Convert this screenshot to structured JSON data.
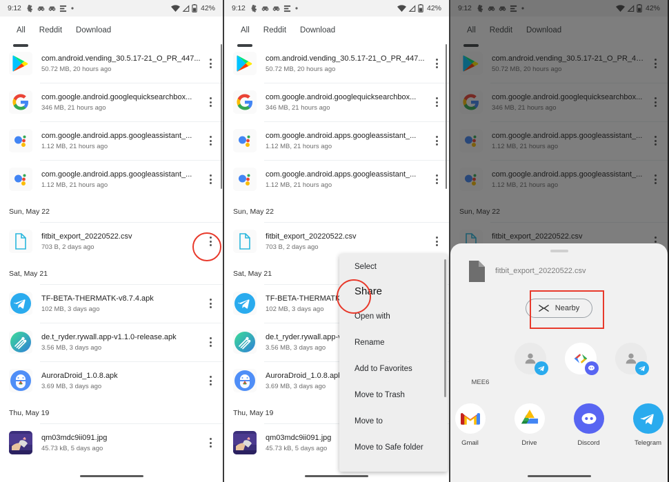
{
  "status_bar": {
    "time": "9:12",
    "battery_text": "42%",
    "left_icons": [
      "app-notification-icon",
      "car-notification-icon",
      "car-notification-icon",
      "list-notification-icon",
      "dot-notification-icon"
    ],
    "right_icons": [
      "wifi-icon",
      "signal-icon",
      "battery-icon"
    ]
  },
  "tabs": [
    {
      "label": "All",
      "selected": true
    },
    {
      "label": "Reddit",
      "selected": false
    },
    {
      "label": "Download",
      "selected": false
    }
  ],
  "files": [
    {
      "name": "com.android.vending_30.5.17-21_O_PR_447...",
      "meta": "50.72 MB, 20 hours ago",
      "icon": "play-store-icon"
    },
    {
      "name": "com.google.android.googlequicksearchbox...",
      "meta": "346 MB, 21 hours ago",
      "icon": "google-icon"
    },
    {
      "name": "com.google.android.apps.googleassistant_...",
      "meta": "1.12 MB, 21 hours ago",
      "icon": "google-assistant-icon"
    },
    {
      "name": "com.google.android.apps.googleassistant_...",
      "meta": "1.12 MB, 21 hours ago",
      "icon": "google-assistant-icon"
    }
  ],
  "groups": [
    {
      "date": "Sun, May 22",
      "files": [
        {
          "name": "fitbit_export_20220522.csv",
          "meta": "703 B, 2 days ago",
          "icon": "csv-document-icon"
        }
      ]
    },
    {
      "date": "Sat, May 21",
      "files": [
        {
          "name": "TF-BETA-THERMATK-v8.7.4.apk",
          "meta": "102 MB, 3 days ago",
          "icon": "telegram-icon"
        },
        {
          "name": "de.t_ryder.rywall.app-v1.1.0-release.apk",
          "meta": "3.56 MB, 3 days ago",
          "icon": "rywall-icon"
        },
        {
          "name": "AuroraDroid_1.0.8.apk",
          "meta": "3.69 MB, 3 days ago",
          "icon": "auroradroid-icon"
        }
      ]
    },
    {
      "date": "Thu, May 19",
      "files": [
        {
          "name": "qm03mdc9ii091.jpg",
          "meta": "45.73 kB, 5 days ago",
          "icon": "photo-thumbnail-icon"
        }
      ]
    }
  ],
  "context_menu": {
    "items": [
      {
        "label": "Select",
        "highlighted": false
      },
      {
        "label": "Share",
        "highlighted": true
      },
      {
        "label": "Open with",
        "highlighted": false
      },
      {
        "label": "Rename",
        "highlighted": false
      },
      {
        "label": "Add to Favorites",
        "highlighted": false
      },
      {
        "label": "Move to Trash",
        "highlighted": false
      },
      {
        "label": "Move to",
        "highlighted": false
      },
      {
        "label": "Move to Safe folder",
        "highlighted": false
      }
    ]
  },
  "share_sheet": {
    "file_name": "fitbit_export_20220522.csv",
    "nearby_label": "Nearby",
    "nearby_icon": "nearby-share-icon",
    "contact_name": "MEE6",
    "contacts": [
      {
        "badge": "telegram-badge-icon"
      },
      {
        "badge": "discord-badge-icon"
      },
      {
        "badge": "telegram-badge-icon"
      }
    ],
    "apps": [
      {
        "name": "Gmail",
        "icon": "gmail-icon"
      },
      {
        "name": "Drive",
        "icon": "google-drive-icon"
      },
      {
        "name": "Discord",
        "icon": "discord-icon"
      },
      {
        "name": "Telegram",
        "icon": "telegram-icon"
      }
    ]
  },
  "annotation_color": "#e8392b"
}
